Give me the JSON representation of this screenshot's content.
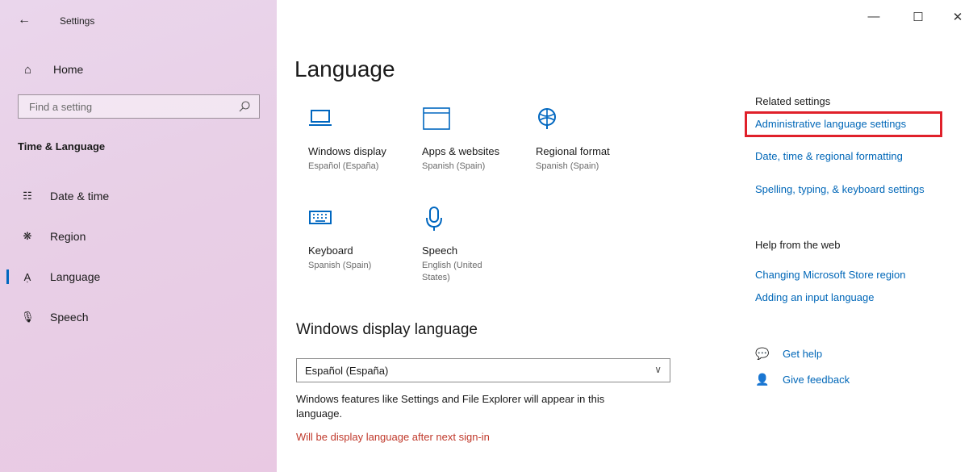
{
  "app": {
    "title": "Settings"
  },
  "sidebar": {
    "home_label": "Home",
    "search_placeholder": "Find a setting",
    "section_title": "Time & Language",
    "items": [
      {
        "label": "Date & time",
        "icon": "calendar-clock-icon"
      },
      {
        "label": "Region",
        "icon": "globe-icon"
      },
      {
        "label": "Language",
        "icon": "language-icon",
        "active": true
      },
      {
        "label": "Speech",
        "icon": "microphone-icon"
      }
    ]
  },
  "main": {
    "title": "Language",
    "tiles": [
      {
        "name": "Windows display",
        "sub": "Español (España)",
        "icon": "laptop-icon"
      },
      {
        "name": "Apps & websites",
        "sub": "Spanish (Spain)",
        "icon": "window-icon"
      },
      {
        "name": "Regional format",
        "sub": "Spanish (Spain)",
        "icon": "globe-icon"
      },
      {
        "name": "Keyboard",
        "sub": "Spanish (Spain)",
        "icon": "keyboard-icon"
      },
      {
        "name": "Speech",
        "sub": "English (United States)",
        "icon": "microphone-icon"
      }
    ],
    "display_language_heading": "Windows display language",
    "dropdown_value": "Español (España)",
    "description": "Windows features like Settings and File Explorer will appear in this language.",
    "warning": "Will be display language after next sign-in"
  },
  "related": {
    "heading": "Related settings",
    "links": [
      "Administrative language settings",
      "Date, time & regional formatting",
      "Spelling, typing, & keyboard settings"
    ]
  },
  "help_web": {
    "heading": "Help from the web",
    "links": [
      "Changing Microsoft Store region",
      "Adding an input language"
    ]
  },
  "support": {
    "get_help": "Get help",
    "give_feedback": "Give feedback"
  },
  "colors": {
    "accent": "#0067b8",
    "warning": "#c0392b",
    "highlight_box": "#e0202a"
  }
}
